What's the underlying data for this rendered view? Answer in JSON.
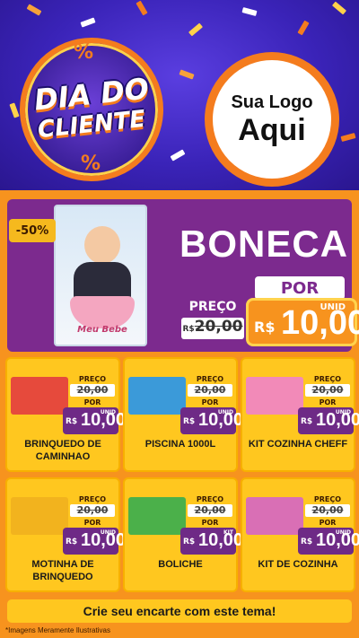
{
  "header": {
    "title_line1": "DIA DO",
    "title_line2": "CLIENTE",
    "percent_symbol": "%",
    "logo_line1": "Sua Logo",
    "logo_line2": "Aqui"
  },
  "hero": {
    "discount": "-50%",
    "title": "BONECA",
    "box_label": "Meu Bebe",
    "por_label": "POR",
    "preco_label": "PREÇO",
    "old_currency": "R$",
    "old_value": "20,00",
    "unid": "UNID",
    "currency": "R$",
    "new_value": "10,00"
  },
  "products": [
    {
      "name": "BRINQUEDO DE CAMINHAO",
      "preco_label": "PREÇO",
      "old_price": "20,00",
      "por_label": "POR",
      "currency": "R$",
      "new_price": "10,00",
      "unit": "UNID",
      "color": "#e64a3c"
    },
    {
      "name": "PISCINA 1000L",
      "preco_label": "PREÇO",
      "old_price": "20,00",
      "por_label": "POR",
      "currency": "R$",
      "new_price": "10,00",
      "unit": "UNID",
      "color": "#3b9ad9"
    },
    {
      "name": "KIT COZINHA CHEFF",
      "preco_label": "PREÇO",
      "old_price": "20,00",
      "por_label": "POR",
      "currency": "R$",
      "new_price": "10,00",
      "unit": "UNID",
      "color": "#f28ab8"
    },
    {
      "name": "MOTINHA DE BRINQUEDO",
      "preco_label": "PREÇO",
      "old_price": "20,00",
      "por_label": "POR",
      "currency": "R$",
      "new_price": "10,00",
      "unit": "UNID",
      "color": "#f2b31e"
    },
    {
      "name": "BOLICHE",
      "preco_label": "PREÇO",
      "old_price": "20,00",
      "por_label": "POR",
      "currency": "R$",
      "new_price": "10,00",
      "unit": "KIT",
      "color": "#4bb04a"
    },
    {
      "name": "KIT DE COZINHA",
      "preco_label": "PREÇO",
      "old_price": "20,00",
      "por_label": "POR",
      "currency": "R$",
      "new_price": "10,00",
      "unit": "UNID",
      "color": "#d96fb5"
    }
  ],
  "footer": {
    "cta": "Crie seu encarte com este tema!",
    "disclaimer": "*Imagens Meramente Ilustrativas"
  },
  "colors": {
    "header_bg": "#3a23b8",
    "accent_orange": "#f47c1e",
    "hero_purple": "#7c2a8e",
    "card_yellow": "#ffc71f"
  }
}
